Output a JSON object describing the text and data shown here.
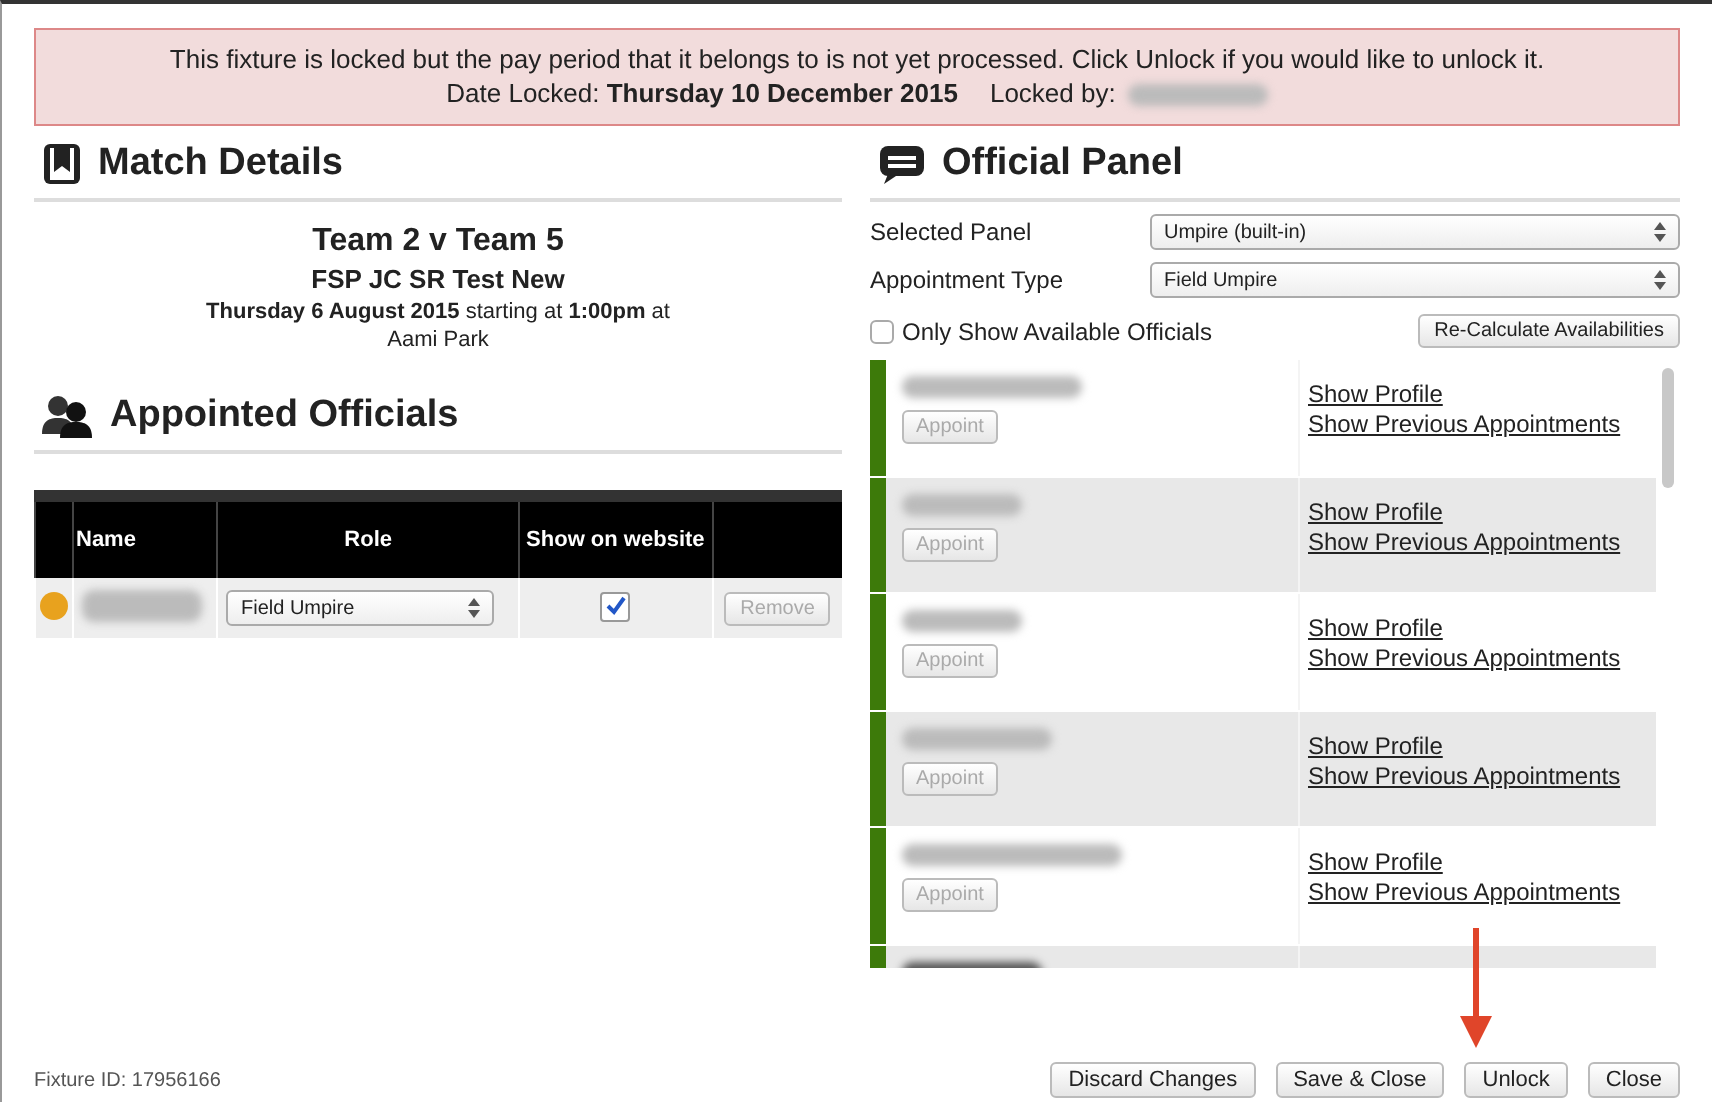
{
  "alert": {
    "message": "This fixture is locked but the pay period that it belongs to is not yet processed. Click Unlock if you would like to unlock it.",
    "date_line": "Date Locked: **Thursday 10 December 2015**",
    "locked_by_label": "Locked by:"
  },
  "match_details": {
    "heading": "Match Details",
    "title": "Team 2 v Team 5",
    "competition": "FSP JC SR Test New",
    "when": "**Thursday 6 August 2015** starting at **1:00pm** at",
    "venue": "Aami Park"
  },
  "appointed_officials": {
    "heading": "Appointed Officials",
    "columns": [
      "Name",
      "Role",
      "Show on website"
    ],
    "rows": [
      {
        "color": "#e8a21e",
        "role": "Field Umpire",
        "show_on_website": true,
        "remove": "Remove",
        "remove_disabled": true
      }
    ]
  },
  "official_panel": {
    "heading": "Official Panel",
    "fields": [
      {
        "label": "Selected Panel",
        "value": "Umpire (built-in)"
      },
      {
        "label": "Appointment Type",
        "value": "Field Umpire"
      }
    ],
    "only_available": {
      "label": "Only Show Available Officials",
      "checked": false
    },
    "recalculate": "Re-Calculate Availabilities",
    "officials": [
      {
        "kind": "full",
        "color": "#3d7a0a",
        "appoint": "Appoint",
        "appoint_disabled": true,
        "links": [
          "Show Profile",
          "Show Previous Appointments"
        ]
      },
      {
        "kind": "full",
        "color": "#3d7a0a",
        "appoint": "Appoint",
        "appoint_disabled": true,
        "links": [
          "Show Profile",
          "Show Previous Appointments"
        ]
      },
      {
        "kind": "full",
        "color": "#3d7a0a",
        "appoint": "Appoint",
        "appoint_disabled": true,
        "links": [
          "Show Profile",
          "Show Previous Appointments"
        ]
      },
      {
        "kind": "full",
        "color": "#3d7a0a",
        "appoint": "Appoint",
        "appoint_disabled": true,
        "links": [
          "Show Profile",
          "Show Previous Appointments"
        ]
      },
      {
        "kind": "full",
        "color": "#3d7a0a",
        "appoint": "Appoint",
        "appoint_disabled": true,
        "links": [
          "Show Profile",
          "Show Previous Appointments"
        ]
      },
      {
        "kind": "cut",
        "color": "#3d7a0a"
      }
    ]
  },
  "footer": {
    "fixture_id": "Fixture ID: 17956166",
    "buttons": [
      "Discard Changes",
      "Save & Close",
      "Unlock",
      "Close"
    ]
  }
}
